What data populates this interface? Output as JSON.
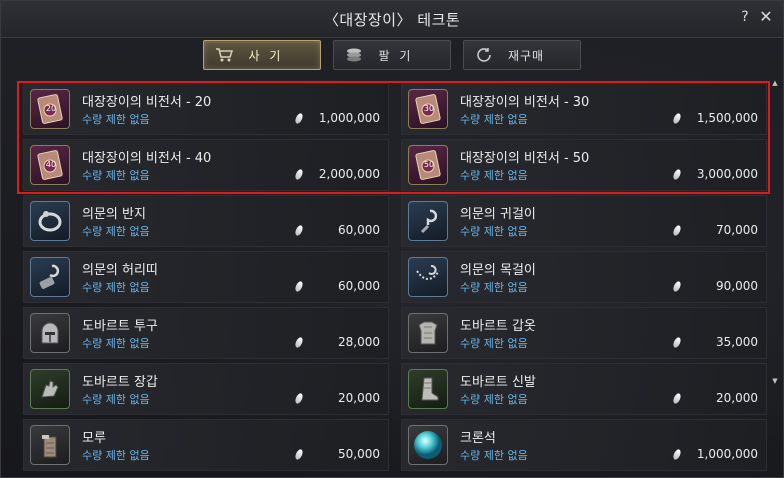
{
  "window": {
    "title": "〈대장장이〉 테크톤",
    "help": "?",
    "close": "✕"
  },
  "tabs": [
    {
      "label": "사 기",
      "icon": "cart-icon",
      "active": true
    },
    {
      "label": "팔 기",
      "icon": "coins-icon",
      "active": false
    },
    {
      "label": "재구매",
      "icon": "refresh-icon",
      "active": false
    }
  ],
  "items": [
    {
      "name": "대장장이의 비전서 - 20",
      "limit": "수량 제한 없음",
      "price": "1,000,000",
      "icon": "book-icon",
      "badge": "20"
    },
    {
      "name": "대장장이의 비전서 - 30",
      "limit": "수량 제한 없음",
      "price": "1,500,000",
      "icon": "book-icon",
      "badge": "30"
    },
    {
      "name": "대장장이의 비전서 - 40",
      "limit": "수량 제한 없음",
      "price": "2,000,000",
      "icon": "book-icon",
      "badge": "40"
    },
    {
      "name": "대장장이의 비전서 - 50",
      "limit": "수량 제한 없음",
      "price": "3,000,000",
      "icon": "book-icon",
      "badge": "50"
    },
    {
      "name": "의문의 반지",
      "limit": "수량 제한 없음",
      "price": "60,000",
      "icon": "ring-icon"
    },
    {
      "name": "의문의 귀걸이",
      "limit": "수량 제한 없음",
      "price": "70,000",
      "icon": "earring-icon"
    },
    {
      "name": "의문의 허리띠",
      "limit": "수량 제한 없음",
      "price": "60,000",
      "icon": "belt-icon"
    },
    {
      "name": "의문의 목걸이",
      "limit": "수량 제한 없음",
      "price": "90,000",
      "icon": "necklace-icon"
    },
    {
      "name": "도바르트 투구",
      "limit": "수량 제한 없음",
      "price": "28,000",
      "icon": "helmet-icon"
    },
    {
      "name": "도바르트 갑옷",
      "limit": "수량 제한 없음",
      "price": "35,000",
      "icon": "armor-icon"
    },
    {
      "name": "도바르트 장갑",
      "limit": "수량 제한 없음",
      "price": "20,000",
      "icon": "gloves-icon"
    },
    {
      "name": "도바르트 신발",
      "limit": "수량 제한 없음",
      "price": "20,000",
      "icon": "boots-icon"
    },
    {
      "name": "모루",
      "limit": "수량 제한 없음",
      "price": "50,000",
      "icon": "anvil-icon"
    },
    {
      "name": "크론석",
      "limit": "수량 제한 없음",
      "price": "1,000,000",
      "icon": "crystal-icon"
    }
  ],
  "colors": {
    "accent": "#b8a36a",
    "limit_text": "#69b6ec",
    "highlight": "#e01a1a"
  }
}
